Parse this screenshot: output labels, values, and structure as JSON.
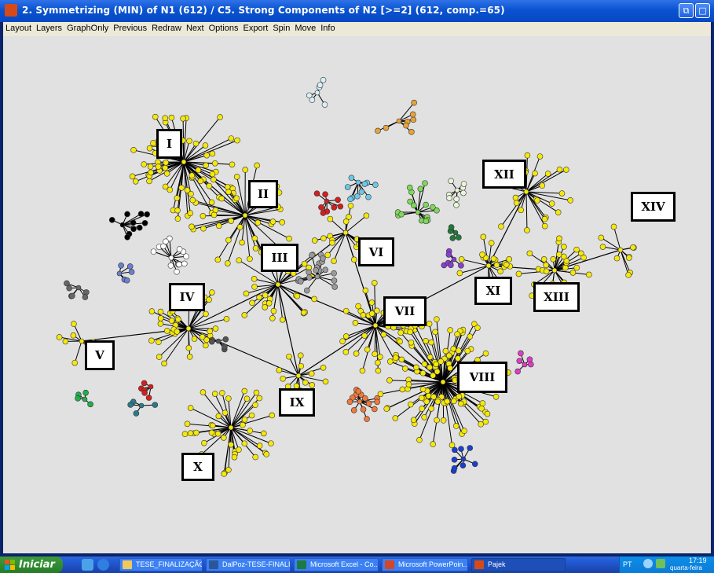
{
  "window": {
    "title": "2. Symmetrizing (MIN) of N1 (612) / C5. Strong Components of N2 [>=2] (612, comp.=65)",
    "buttons": {
      "restore": "⧉",
      "maximize": "□"
    }
  },
  "menu": [
    "Layout",
    "Layers",
    "GraphOnly",
    "Previous",
    "Redraw",
    "Next",
    "Options",
    "Export",
    "Spin",
    "Move",
    "Info"
  ],
  "labels": [
    "I",
    "II",
    "III",
    "IV",
    "V",
    "VI",
    "VII",
    "VIII",
    "IX",
    "X",
    "XI",
    "XII",
    "XIII",
    "XIV"
  ],
  "colors": {
    "node_default": "#f5e80a",
    "edge": "#000000",
    "canvas_bg": "#e1e1e1",
    "titlebar": "#0a53d0",
    "taskbar": "#245edb"
  },
  "taskbar": {
    "start": "Iniciar",
    "tasks": [
      "TESE_FINALIZAÇÃO",
      "DalPoz-TESE-FINALI...",
      "Microsoft Excel - Co...",
      "Microsoft PowerPoin...",
      "Pajek"
    ],
    "lang": "PT",
    "time": "17:19",
    "day": "quarta-feira"
  },
  "icons": {
    "app": "pajek-icon",
    "start": "windows-logo-icon",
    "quick_launch": [
      "show-desktop-icon",
      "internet-explorer-icon"
    ],
    "tasks": [
      "folder-icon",
      "word-icon",
      "excel-icon",
      "powerpoint-icon",
      "pajek-icon"
    ],
    "tray": [
      "network-icon",
      "user-icon"
    ]
  }
}
